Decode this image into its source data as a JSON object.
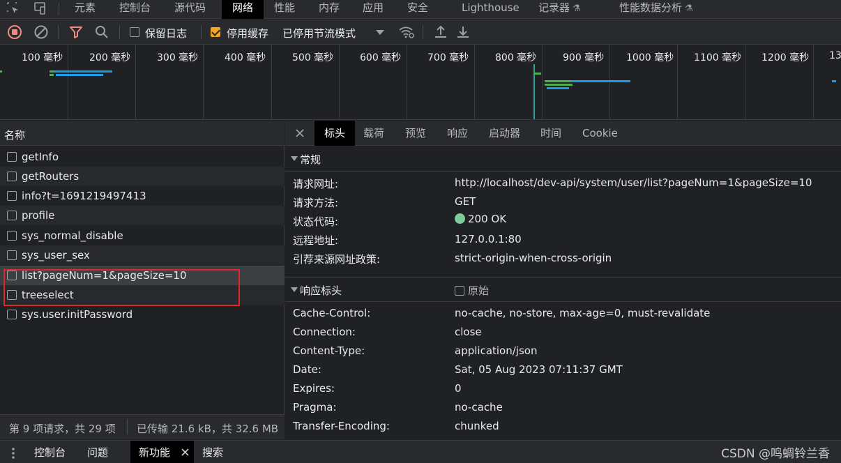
{
  "top_tabs": [
    {
      "label": "元素"
    },
    {
      "label": "控制台"
    },
    {
      "label": "源代码"
    },
    {
      "label": "网络"
    },
    {
      "label": "性能"
    },
    {
      "label": "内存"
    },
    {
      "label": "应用"
    },
    {
      "label": "安全"
    },
    {
      "label": "Lighthouse"
    },
    {
      "label": "记录器"
    },
    {
      "label": "性能数据分析"
    }
  ],
  "toolbar": {
    "preserve_log_label": "保留日志",
    "preserve_log_checked": false,
    "disable_cache_label": "停用缓存",
    "disable_cache_checked": true,
    "throttle_label": "已停用节流模式"
  },
  "timeline": {
    "ticks": [
      "100 毫秒",
      "200 毫秒",
      "300 毫秒",
      "400 毫秒",
      "500 毫秒",
      "600 毫秒",
      "700 毫秒",
      "800 毫秒",
      "900 毫秒",
      "1000 毫秒",
      "1100 毫秒",
      "1200 毫秒",
      "13"
    ]
  },
  "requests": {
    "header": "名称",
    "items": [
      {
        "name": "getInfo"
      },
      {
        "name": "getRouters"
      },
      {
        "name": "info?t=1691219497413"
      },
      {
        "name": "profile"
      },
      {
        "name": "sys_normal_disable"
      },
      {
        "name": "sys_user_sex"
      },
      {
        "name": "list?pageNum=1&pageSize=10"
      },
      {
        "name": "treeselect"
      },
      {
        "name": "sys.user.initPassword"
      }
    ],
    "summary_requests": "第 9 项请求，共 29 项",
    "summary_transfer": "已传输 21.6 kB，共 32.6 MB"
  },
  "detail_tabs": [
    {
      "label": "标头"
    },
    {
      "label": "载荷"
    },
    {
      "label": "预览"
    },
    {
      "label": "响应"
    },
    {
      "label": "启动器"
    },
    {
      "label": "时间"
    },
    {
      "label": "Cookie"
    }
  ],
  "general": {
    "title": "常规",
    "rows": [
      {
        "key": "请求网址:",
        "value": "http://localhost/dev-api/system/user/list?pageNum=1&pageSize=10"
      },
      {
        "key": "请求方法:",
        "value": "GET"
      },
      {
        "key": "状态代码:",
        "value": "200 OK"
      },
      {
        "key": "远程地址:",
        "value": "127.0.0.1:80"
      },
      {
        "key": "引荐来源网址政策:",
        "value": "strict-origin-when-cross-origin"
      }
    ]
  },
  "response_headers": {
    "title": "响应标头",
    "raw_label": "原始",
    "rows": [
      {
        "key": "Cache-Control:",
        "value": "no-cache, no-store, max-age=0, must-revalidate"
      },
      {
        "key": "Connection:",
        "value": "close"
      },
      {
        "key": "Content-Type:",
        "value": "application/json"
      },
      {
        "key": "Date:",
        "value": "Sat, 05 Aug 2023 07:11:37 GMT"
      },
      {
        "key": "Expires:",
        "value": "0"
      },
      {
        "key": "Pragma:",
        "value": "no-cache"
      },
      {
        "key": "Transfer-Encoding:",
        "value": "chunked"
      }
    ]
  },
  "drawer_tabs": [
    {
      "label": "控制台"
    },
    {
      "label": "问题"
    },
    {
      "label": "新功能"
    },
    {
      "label": "搜索"
    }
  ],
  "watermark": "CSDN @鸣蜩铃兰香",
  "colors": {
    "accent": "#f5a623",
    "record_red": "#f28b82",
    "status_ok": "#81c995",
    "highlight_box": "#e0262d"
  }
}
